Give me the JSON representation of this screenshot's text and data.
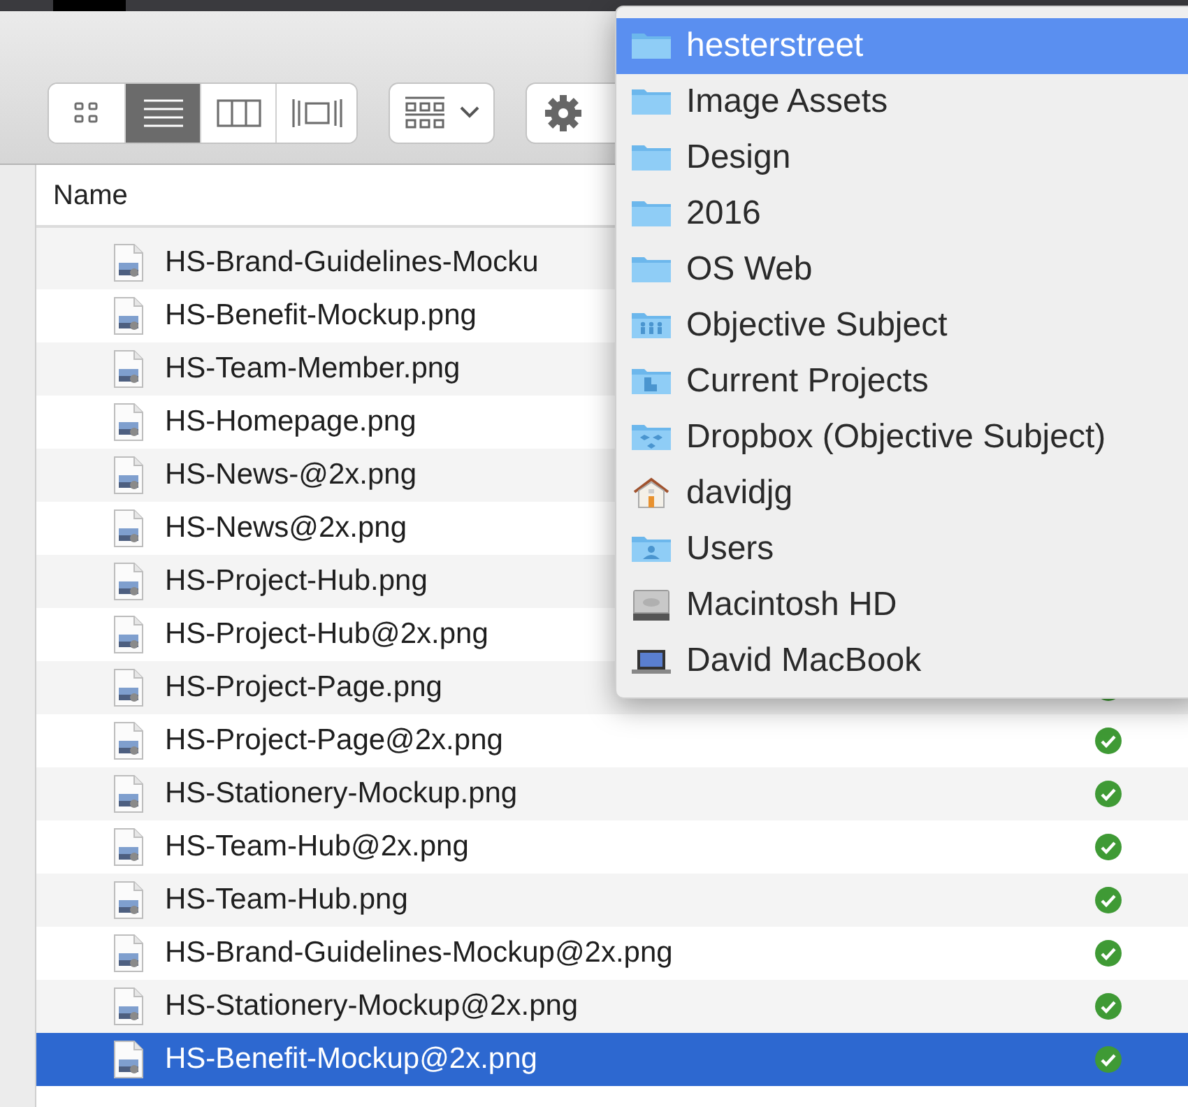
{
  "toolbar": {
    "view_buttons": [
      {
        "kind": "icons",
        "selected": false
      },
      {
        "kind": "list",
        "selected": true
      },
      {
        "kind": "columns",
        "selected": false
      },
      {
        "kind": "coverflow",
        "selected": false
      }
    ]
  },
  "table": {
    "columns": [
      "Name"
    ],
    "rows": [
      {
        "name": "HS-Brand-Guidelines-Mocku",
        "selected": false
      },
      {
        "name": "HS-Benefit-Mockup.png",
        "selected": false
      },
      {
        "name": "HS-Team-Member.png",
        "selected": false
      },
      {
        "name": "HS-Homepage.png",
        "selected": false
      },
      {
        "name": "HS-News-@2x.png",
        "selected": false
      },
      {
        "name": "HS-News@2x.png",
        "selected": false
      },
      {
        "name": "HS-Project-Hub.png",
        "selected": false
      },
      {
        "name": "HS-Project-Hub@2x.png",
        "selected": false
      },
      {
        "name": "HS-Project-Page.png",
        "selected": false,
        "synced": true
      },
      {
        "name": "HS-Project-Page@2x.png",
        "selected": false,
        "synced": true
      },
      {
        "name": "HS-Stationery-Mockup.png",
        "selected": false,
        "synced": true
      },
      {
        "name": "HS-Team-Hub@2x.png",
        "selected": false,
        "synced": true
      },
      {
        "name": "HS-Team-Hub.png",
        "selected": false,
        "synced": true
      },
      {
        "name": "HS-Brand-Guidelines-Mockup@2x.png",
        "selected": false,
        "synced": true
      },
      {
        "name": "HS-Stationery-Mockup@2x.png",
        "selected": false,
        "synced": true
      },
      {
        "name": "HS-Benefit-Mockup@2x.png",
        "selected": true,
        "synced": true
      }
    ]
  },
  "path_menu": {
    "items": [
      {
        "label": "hesterstreet",
        "kind": "folder",
        "selected": true
      },
      {
        "label": "Image Assets",
        "kind": "folder",
        "selected": false
      },
      {
        "label": "Design",
        "kind": "folder",
        "selected": false
      },
      {
        "label": "2016",
        "kind": "folder",
        "selected": false
      },
      {
        "label": "OS Web",
        "kind": "folder",
        "selected": false
      },
      {
        "label": "Objective Subject",
        "kind": "group-folder",
        "selected": false
      },
      {
        "label": "Current Projects",
        "kind": "building-folder",
        "selected": false
      },
      {
        "label": "Dropbox (Objective Subject)",
        "kind": "dropbox-folder",
        "selected": false
      },
      {
        "label": "davidjg",
        "kind": "home",
        "selected": false
      },
      {
        "label": "Users",
        "kind": "users-folder",
        "selected": false
      },
      {
        "label": "Macintosh HD",
        "kind": "disk",
        "selected": false
      },
      {
        "label": "David MacBook",
        "kind": "laptop",
        "selected": false
      }
    ]
  }
}
